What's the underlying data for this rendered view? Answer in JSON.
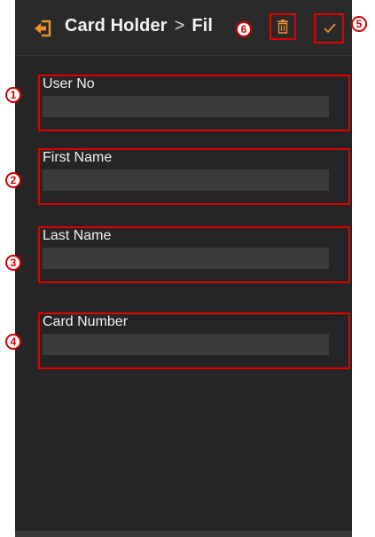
{
  "header": {
    "title": "Card Holder",
    "separator": ">",
    "subtitle": "Fil",
    "back_icon": "back-arrow-icon",
    "delete_icon": "trash-icon",
    "confirm_icon": "checkmark-icon"
  },
  "fields": [
    {
      "label": "User No",
      "value": ""
    },
    {
      "label": "First Name",
      "value": ""
    },
    {
      "label": "Last Name",
      "value": ""
    },
    {
      "label": "Card Number",
      "value": ""
    }
  ],
  "callouts": [
    "1",
    "2",
    "3",
    "4",
    "5",
    "6"
  ],
  "colors": {
    "highlight": "#e00000",
    "accent": "#e8902a",
    "background": "#252525",
    "input": "#3c3c3c"
  }
}
